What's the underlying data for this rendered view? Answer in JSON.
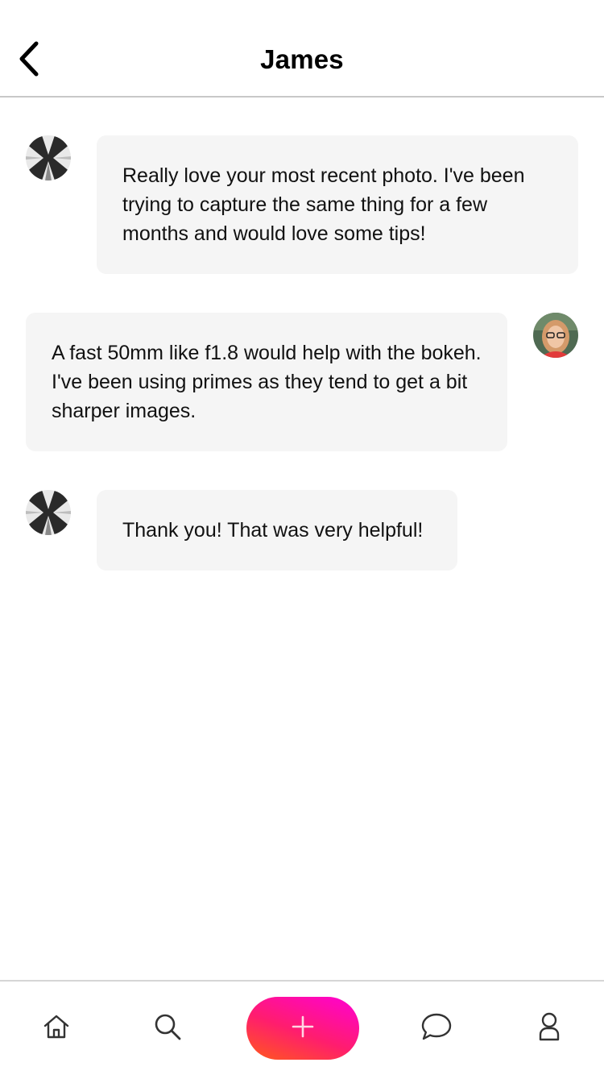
{
  "header": {
    "title": "James",
    "back_icon": "chevron-left-icon"
  },
  "messages": [
    {
      "sender": "James",
      "direction": "incoming",
      "text": "Really love your most recent photo. I've been trying to capture the same thing for a few months and would love some tips!"
    },
    {
      "sender": "me",
      "direction": "outgoing",
      "text": "A fast 50mm like f1.8 would help with the bokeh. I've been using primes as they tend to get a bit sharper images."
    },
    {
      "sender": "James",
      "direction": "incoming",
      "text": "Thank you! That was very helpful!"
    }
  ],
  "bottom_nav": {
    "items": [
      {
        "icon": "home-icon"
      },
      {
        "icon": "search-icon"
      },
      {
        "icon": "plus-icon"
      },
      {
        "icon": "chat-bubble-icon"
      },
      {
        "icon": "profile-icon"
      }
    ]
  },
  "colors": {
    "bubble_bg": "#f5f5f5",
    "create_gradient_start": "#ff00d4",
    "create_gradient_end": "#ff5a1a"
  }
}
